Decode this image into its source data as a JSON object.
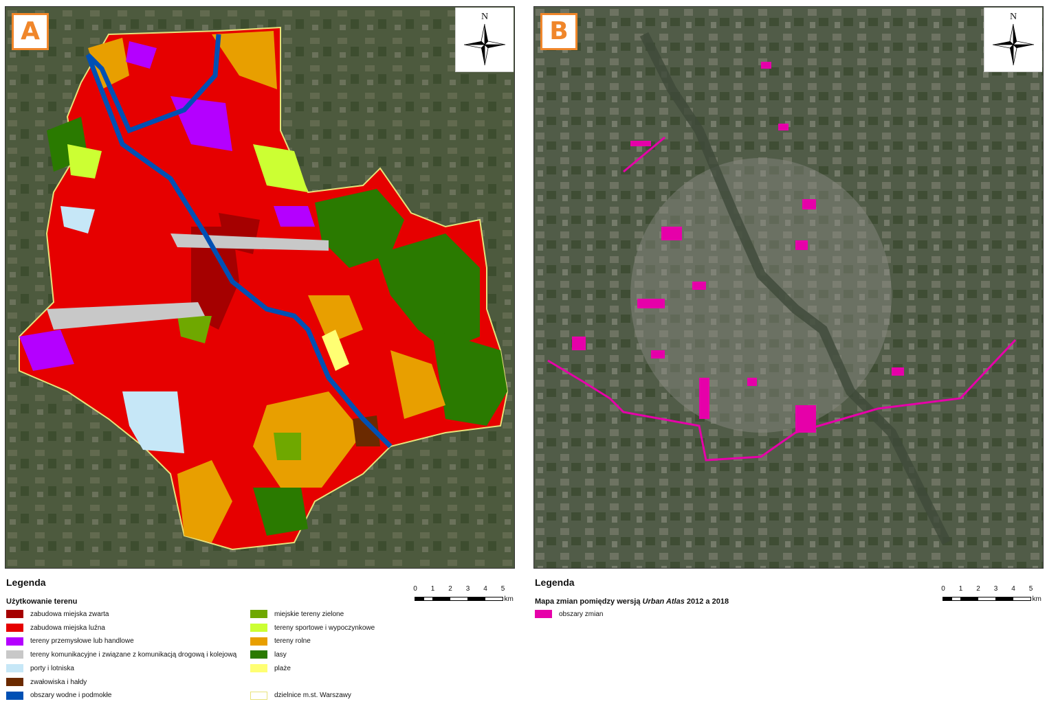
{
  "panels": {
    "a": {
      "label": "A"
    },
    "b": {
      "label": "B"
    }
  },
  "north_label": "N",
  "legend_a": {
    "title": "Legenda",
    "subtitle": "Użytkowanie terenu",
    "items": [
      {
        "label": "zabudowa miejska zwarta",
        "color": "#a50000"
      },
      {
        "label": "zabudowa miejska luźna",
        "color": "#e60000"
      },
      {
        "label": "tereny przemysłowe lub handlowe",
        "color": "#b400ff"
      },
      {
        "label": "tereny komunikacyjne i związane z komunikacją drogową i kolejową",
        "color": "#c8c8c8"
      },
      {
        "label": "porty i lotniska",
        "color": "#c6e7f7"
      },
      {
        "label": "zwałowiska i hałdy",
        "color": "#6b2a00"
      },
      {
        "label": "obszary wodne i podmokłe",
        "color": "#0050b4"
      },
      {
        "label": "miejskie tereny zielone",
        "color": "#6fa800"
      },
      {
        "label": "tereny sportowe i wypoczynkowe",
        "color": "#ccff33"
      },
      {
        "label": "tereny rolne",
        "color": "#e89f00"
      },
      {
        "label": "lasy",
        "color": "#2a7a00"
      },
      {
        "label": "plaże",
        "color": "#ffff73"
      },
      {
        "label": "dzielnice m.st. Warszawy",
        "color": "#e8e27a"
      }
    ]
  },
  "legend_b": {
    "title": "Legenda",
    "subtitle_prefix": "Mapa zmian pomiędzy wersją ",
    "subtitle_italic": "Urban Atlas",
    "subtitle_suffix": " 2012 a 2018",
    "items": [
      {
        "label": "obszary zmian",
        "color": "#e600a9"
      }
    ]
  },
  "scale": {
    "ticks": [
      "0",
      "1",
      "2",
      "3",
      "4",
      "5"
    ],
    "unit": "km"
  }
}
